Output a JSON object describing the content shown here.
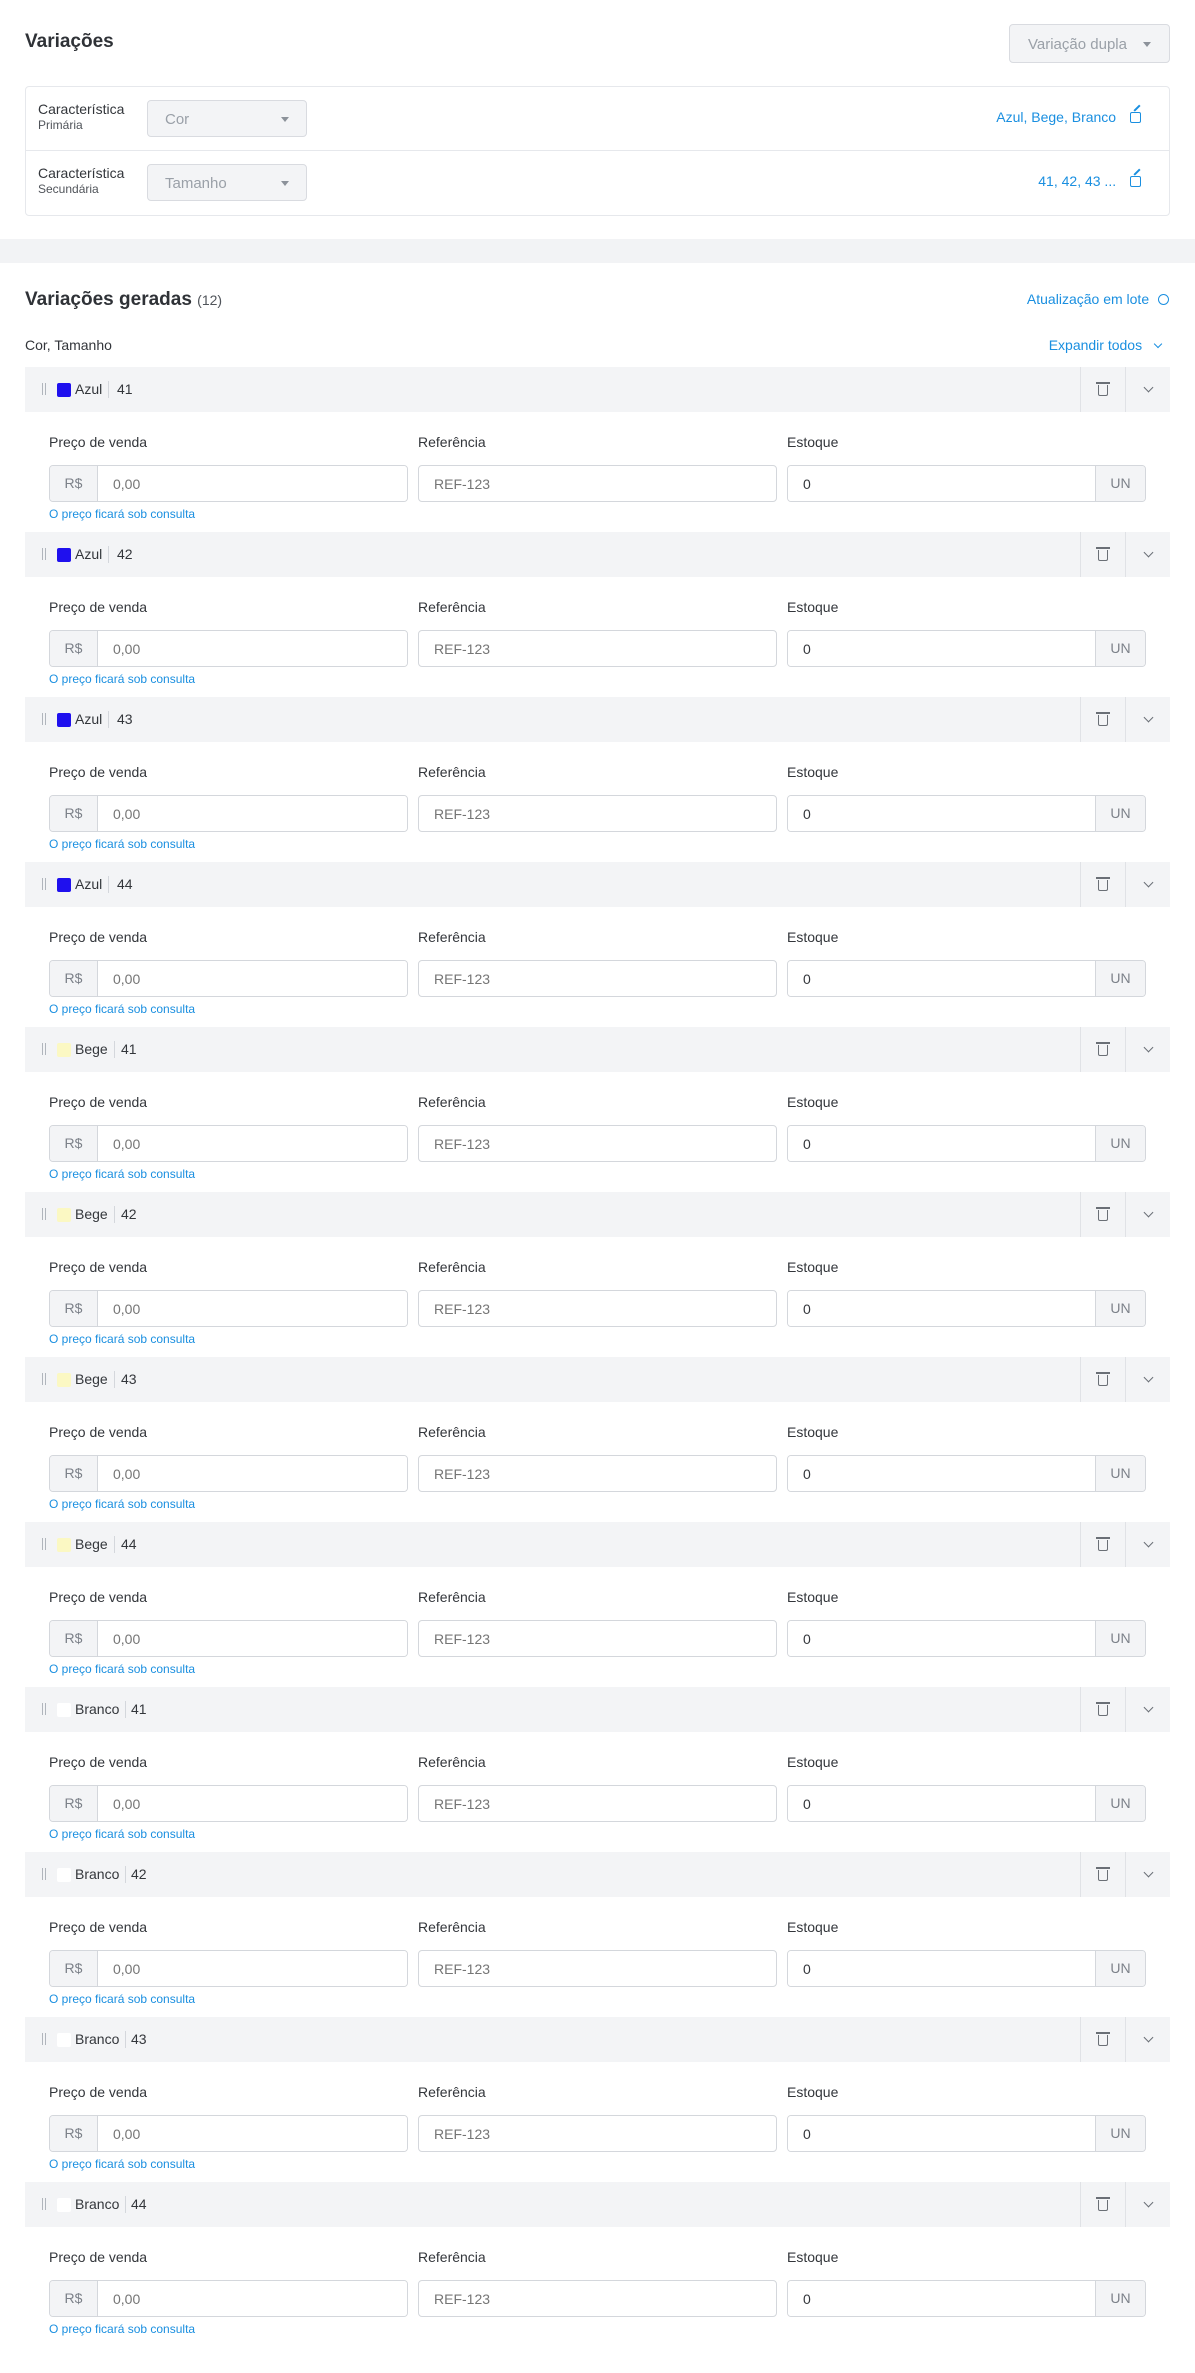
{
  "variations": {
    "title": "Variações",
    "mode_select": "Variação dupla",
    "characteristics": [
      {
        "label": "Característica",
        "sublabel": "Primária",
        "select": "Cor",
        "values": "Azul, Bege, Branco"
      },
      {
        "label": "Característica",
        "sublabel": "Secundária",
        "select": "Tamanho",
        "values": "41, 42, 43 ..."
      }
    ]
  },
  "generated": {
    "title": "Variações geradas",
    "count": "(12)",
    "batch_update": "Atualização em lote",
    "combination": "Cor, Tamanho",
    "expand_all": "Expandir todos",
    "fields": {
      "price_label": "Preço de venda",
      "reference_label": "Referência",
      "stock_label": "Estoque",
      "currency": "R$",
      "price_placeholder": "0,00",
      "reference_placeholder": "REF-123",
      "stock_value": "0",
      "unit": "UN",
      "consult_note": "O preço ficará sob consulta"
    },
    "colors": {
      "Azul": "#1f10ee",
      "Bege": "#fbf8c3",
      "Branco": "#ffffff"
    },
    "items": [
      {
        "color": "Azul",
        "size": "41"
      },
      {
        "color": "Azul",
        "size": "42"
      },
      {
        "color": "Azul",
        "size": "43"
      },
      {
        "color": "Azul",
        "size": "44"
      },
      {
        "color": "Bege",
        "size": "41"
      },
      {
        "color": "Bege",
        "size": "42"
      },
      {
        "color": "Bege",
        "size": "43"
      },
      {
        "color": "Bege",
        "size": "44"
      },
      {
        "color": "Branco",
        "size": "41"
      },
      {
        "color": "Branco",
        "size": "42"
      },
      {
        "color": "Branco",
        "size": "43"
      },
      {
        "color": "Branco",
        "size": "44"
      }
    ]
  }
}
